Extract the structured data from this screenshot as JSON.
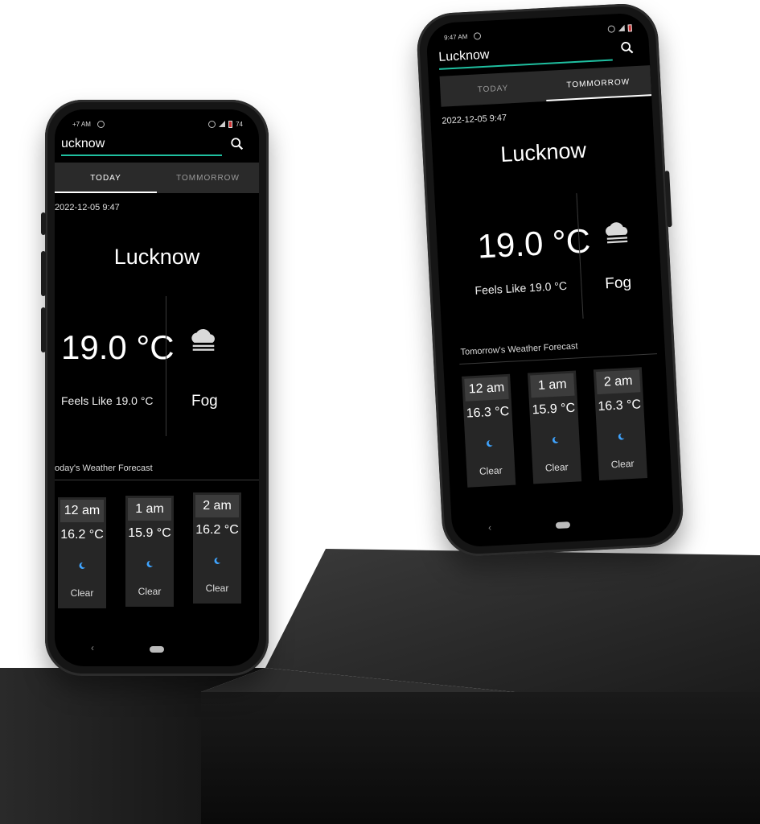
{
  "colors": {
    "accent": "#1fbfa0",
    "tab_bg": "#2a2a2a",
    "card_bg": "#262626",
    "moon": "#3fa4ff"
  },
  "phone_left": {
    "status": {
      "time": "+7 AM",
      "battery": "74"
    },
    "search": {
      "value": "ucknow"
    },
    "tabs": [
      {
        "label": "TODAY",
        "active": true
      },
      {
        "label": "TOMMORROW",
        "active": false
      }
    ],
    "datetime": "2022-12-05 9:47",
    "city": "Lucknow",
    "temperature": "19.0 °C",
    "feels_like": "Feels Like 19.0 °C",
    "condition": "Fog",
    "condition_icon": "cloud-fog-icon",
    "forecast_title": "oday's Weather Forecast",
    "forecast": [
      {
        "hour": "12 am",
        "temp": "16.2 °C",
        "icon": "moon-icon",
        "desc": "Clear"
      },
      {
        "hour": "1 am",
        "temp": "15.9 °C",
        "icon": "moon-icon",
        "desc": "Clear"
      },
      {
        "hour": "2 am",
        "temp": "16.2 °C",
        "icon": "moon-icon",
        "desc": "Clear"
      }
    ],
    "nav": {
      "back": "‹"
    }
  },
  "phone_right": {
    "status": {
      "time": "9:47 AM"
    },
    "search": {
      "value": "Lucknow"
    },
    "tabs": [
      {
        "label": "TODAY",
        "active": false
      },
      {
        "label": "TOMMORROW",
        "active": true
      }
    ],
    "datetime": "2022-12-05 9:47",
    "city": "Lucknow",
    "temperature": "19.0 °C",
    "feels_like": "Feels Like 19.0 °C",
    "condition": "Fog",
    "condition_icon": "cloud-fog-icon",
    "forecast_title": "Tomorrow's Weather Forecast",
    "forecast": [
      {
        "hour": "12 am",
        "temp": "16.3 °C",
        "icon": "moon-icon",
        "desc": "Clear"
      },
      {
        "hour": "1 am",
        "temp": "15.9 °C",
        "icon": "moon-icon",
        "desc": "Clear"
      },
      {
        "hour": "2 am",
        "temp": "16.3 °C",
        "icon": "moon-icon",
        "desc": "Clear"
      }
    ],
    "nav": {
      "back": "‹"
    }
  }
}
